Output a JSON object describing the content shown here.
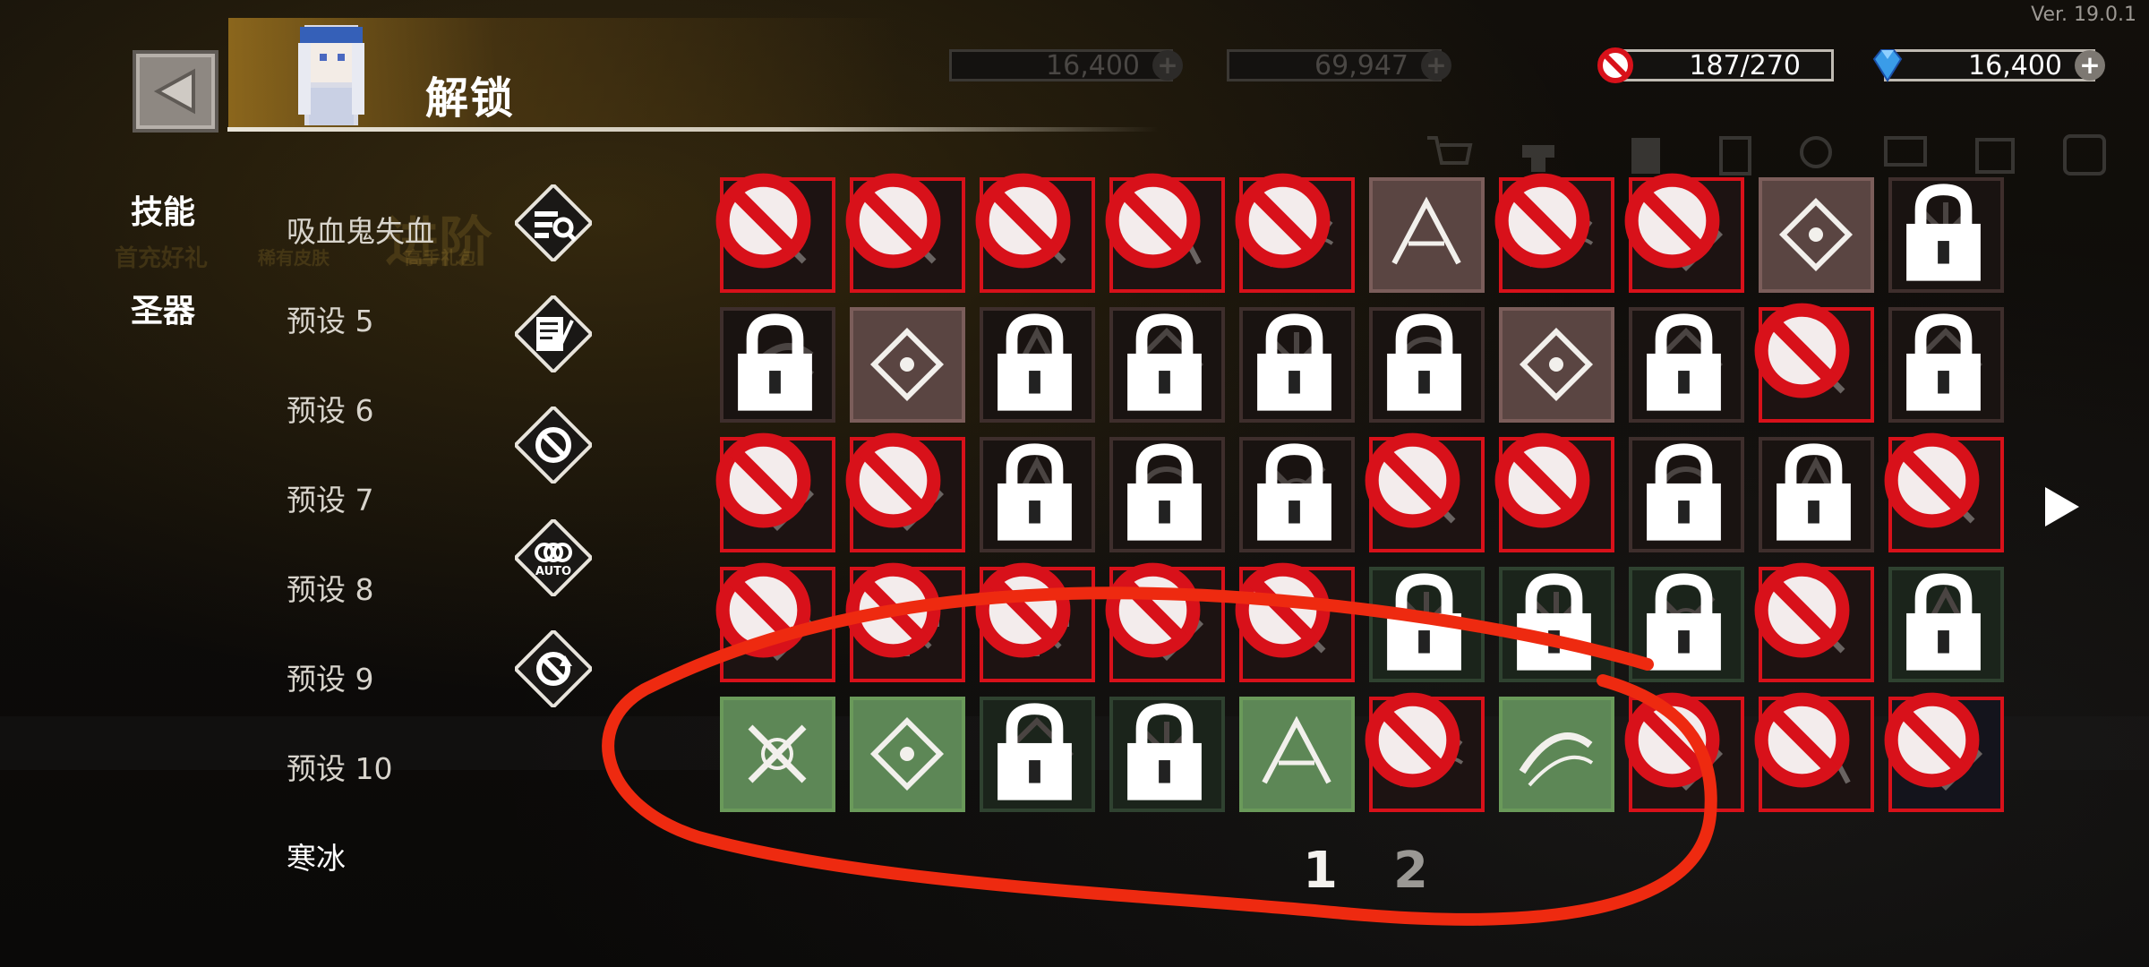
{
  "version": "Ver. 19.0.1",
  "header": {
    "title": "解锁"
  },
  "currencies": {
    "ghost1": "16,400",
    "ghost2": "69,947",
    "unlock_count": "187/270",
    "gems": "16,400",
    "plus": "+"
  },
  "categories": [
    "技能",
    "圣器"
  ],
  "presets": [
    "吸血鬼失血",
    "预设 5",
    "预设 6",
    "预设 7",
    "预设 8",
    "预设 9",
    "预设 10",
    "寒冰"
  ],
  "tools": [
    "search-filter-icon",
    "scroll-list-icon",
    "ban-toggle-icon",
    "auto-rings-icon",
    "refresh-ban-icon"
  ],
  "tools_auto_label": "AUTO",
  "bg_texts": [
    "首充好礼",
    "稀有皮肤",
    "高手礼包",
    "进阶"
  ],
  "colors": {
    "red_border": "#d8111a",
    "green_cell": "#5d8756",
    "annotation": "#ee2a10"
  },
  "grid": {
    "rows": [
      [
        {
          "state": "red",
          "badge": "ban",
          "icon": "slash-swirl"
        },
        {
          "state": "red",
          "badge": "ban",
          "icon": "blade-swipe"
        },
        {
          "state": "red",
          "badge": "ban",
          "icon": "flame-burst"
        },
        {
          "state": "red",
          "badge": "ban",
          "icon": "sparkle-burst"
        },
        {
          "state": "red",
          "badge": "ban",
          "icon": "arrow-up"
        },
        {
          "state": "pink",
          "badge": "none",
          "icon": "snowflake-orb"
        },
        {
          "state": "red",
          "badge": "ban",
          "icon": "fire-orb"
        },
        {
          "state": "red",
          "badge": "ban",
          "icon": "thorn-ring"
        },
        {
          "state": "pink",
          "badge": "none",
          "icon": "arrow-rain"
        },
        {
          "state": "locked",
          "badge": "lock",
          "icon": "biohazard"
        }
      ],
      [
        {
          "state": "locked",
          "badge": "lock",
          "icon": "crescent"
        },
        {
          "state": "pink",
          "badge": "none",
          "icon": "wind-slash"
        },
        {
          "state": "locked",
          "badge": "lock",
          "icon": "feather"
        },
        {
          "state": "locked",
          "badge": "lock",
          "icon": "cross-star"
        },
        {
          "state": "locked",
          "badge": "lock",
          "icon": "ice-sword"
        },
        {
          "state": "locked",
          "badge": "lock",
          "icon": "vortex"
        },
        {
          "state": "pink",
          "badge": "none",
          "icon": "target-orb"
        },
        {
          "state": "locked",
          "badge": "lock",
          "icon": "thorn-vine"
        },
        {
          "state": "red",
          "badge": "ban",
          "icon": "smoke-cloud"
        },
        {
          "state": "locked",
          "badge": "lock",
          "icon": "fist"
        }
      ],
      [
        {
          "state": "red",
          "badge": "ban",
          "icon": "ring-orbit"
        },
        {
          "state": "red",
          "badge": "ban",
          "icon": "claw-marks"
        },
        {
          "state": "locked",
          "badge": "lock",
          "icon": "lightning-orb"
        },
        {
          "state": "locked",
          "badge": "lock",
          "icon": "slash-streak"
        },
        {
          "state": "locked",
          "badge": "lock",
          "icon": "spear"
        },
        {
          "state": "red",
          "badge": "ban",
          "icon": "cross-slash"
        },
        {
          "state": "red",
          "badge": "ban",
          "icon": "zigzag"
        },
        {
          "state": "locked",
          "badge": "lock",
          "icon": "meteor"
        },
        {
          "state": "locked",
          "badge": "lock",
          "icon": "ground-spikes"
        },
        {
          "state": "red",
          "badge": "ban",
          "icon": "grass-burst"
        }
      ],
      [
        {
          "state": "red",
          "badge": "ban",
          "icon": "wave"
        },
        {
          "state": "red",
          "badge": "ban",
          "icon": "bat"
        },
        {
          "state": "red",
          "badge": "ban",
          "icon": "lightning"
        },
        {
          "state": "red",
          "badge": "ban",
          "icon": "hand"
        },
        {
          "state": "red",
          "badge": "ban",
          "icon": "skull"
        },
        {
          "state": "dimgreen",
          "badge": "lock",
          "icon": "explosion"
        },
        {
          "state": "dimgreen",
          "badge": "lock",
          "icon": "biohazard"
        },
        {
          "state": "dimgreen",
          "badge": "lock",
          "icon": "hammer-line"
        },
        {
          "state": "red",
          "badge": "ban",
          "icon": "flask"
        },
        {
          "state": "dimgreen",
          "badge": "lock",
          "icon": "crescent-spin"
        }
      ],
      [
        {
          "state": "green",
          "badge": "none",
          "icon": "holy-swords"
        },
        {
          "state": "green",
          "badge": "none",
          "icon": "wing-skull"
        },
        {
          "state": "dimgreen",
          "badge": "lock",
          "icon": "spark-dark"
        },
        {
          "state": "dimgreen",
          "badge": "lock",
          "icon": "dots-dark"
        },
        {
          "state": "green",
          "badge": "none",
          "icon": "crystal-shard"
        },
        {
          "state": "red",
          "badge": "ban",
          "icon": "shuriken"
        },
        {
          "state": "green",
          "badge": "none",
          "icon": "gear-orb"
        },
        {
          "state": "red",
          "badge": "ban",
          "icon": "thin-slash"
        },
        {
          "state": "red",
          "badge": "ban",
          "icon": "droplet"
        },
        {
          "state": "darkblue",
          "badge": "ban",
          "icon": "hex-shield"
        }
      ]
    ]
  },
  "annotation": {
    "page_labels": [
      "1",
      "2"
    ]
  }
}
